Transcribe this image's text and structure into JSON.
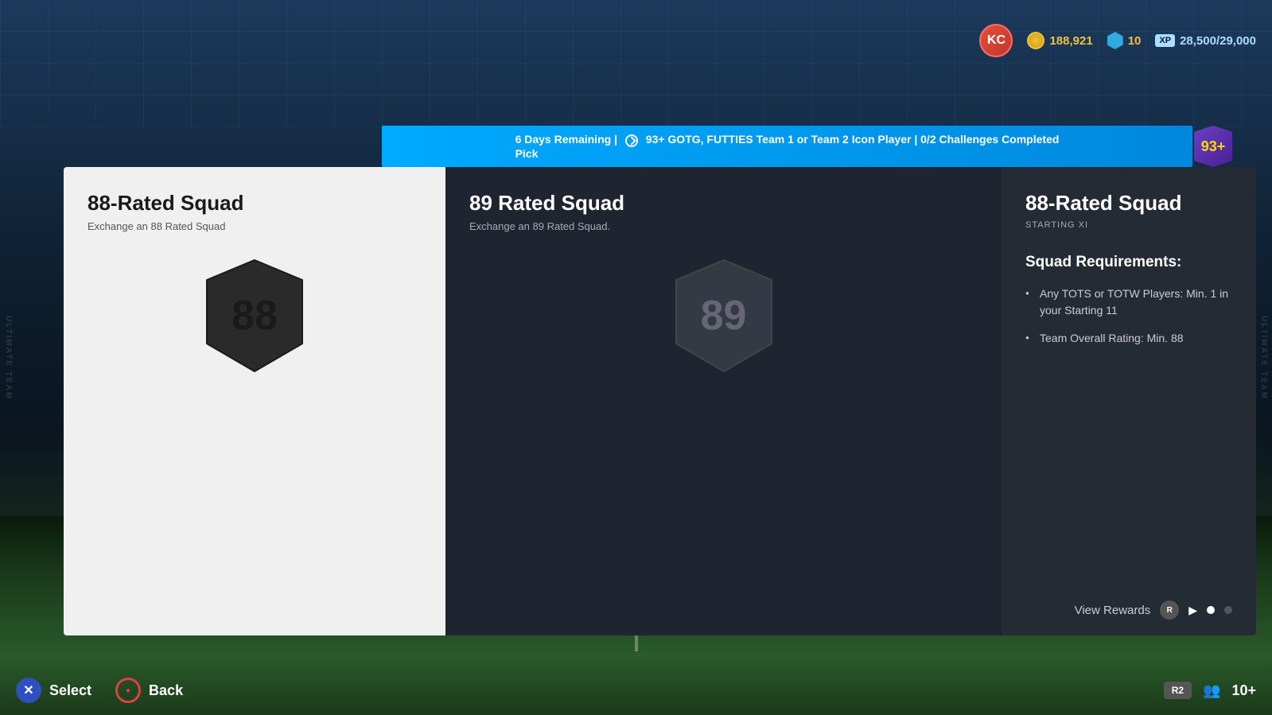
{
  "topbar": {
    "avatar_initials": "KC",
    "coins": "188,921",
    "shield_count": "10",
    "xp_label": "XP",
    "xp_current": "28,500",
    "xp_max": "29,000",
    "xp_display": "28,500/29,000"
  },
  "banner": {
    "days_remaining": "6 Days Remaining",
    "separator": "|",
    "reward_text": "93+ GOTG, FUTTIES Team 1 or Team 2 Icon Player",
    "challenges": "0/2 Challenges Completed",
    "pick_label": "Pick",
    "badge_number": "93+"
  },
  "cards": {
    "left": {
      "title": "88-Rated Squad",
      "subtitle": "Exchange an 88 Rated Squad",
      "rating": "88"
    },
    "middle": {
      "title": "89 Rated Squad",
      "subtitle": "Exchange an 89 Rated Squad.",
      "rating": "89"
    },
    "right": {
      "title": "88-Rated Squad",
      "subtitle": "STARTING XI",
      "requirements_title": "Squad Requirements:",
      "requirements": [
        "Any TOTS or TOTW Players: Min. 1 in your Starting 11",
        "Team Overall Rating: Min. 88"
      ],
      "view_rewards": "View Rewards"
    }
  },
  "bottom": {
    "select_label": "Select",
    "back_label": "Back",
    "r2_label": "R2",
    "people_count": "10+"
  },
  "watermarks": {
    "left": "ULTIMATE TEAM",
    "right": "ULTIMATE TEAM"
  }
}
